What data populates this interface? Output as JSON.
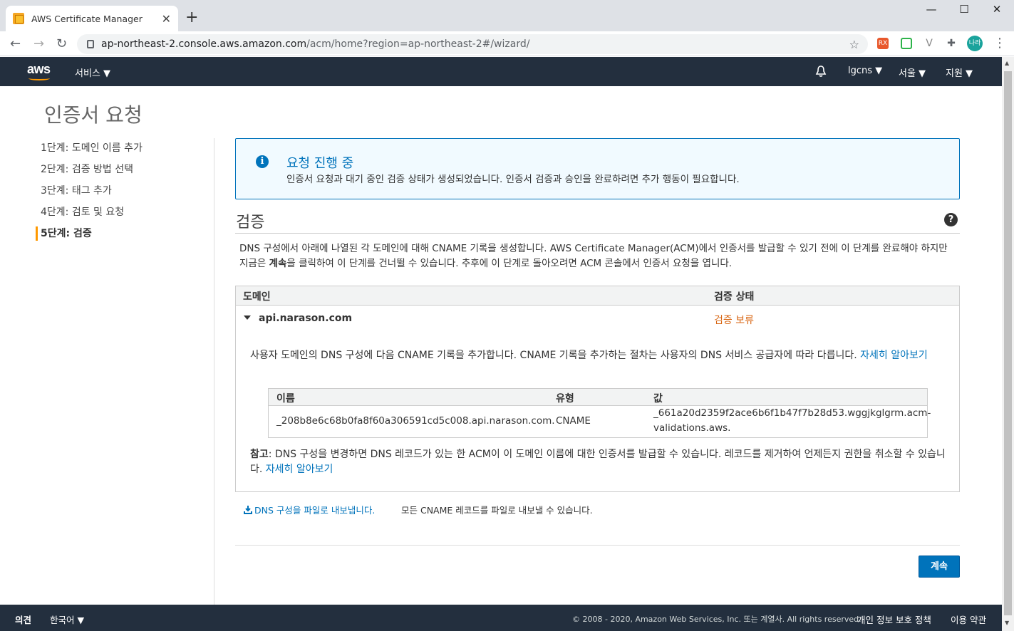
{
  "browser": {
    "tab_title": "AWS Certificate Manager",
    "url_host": "ap-northeast-2.console.aws.amazon.com",
    "url_path": "/acm/home?region=ap-northeast-2#/wizard/",
    "profile_label": "나라",
    "ext_label": "RX"
  },
  "header": {
    "logo": "aws",
    "services": "서비스 ▼",
    "account": "lgcns ▼",
    "region": "서울 ▼",
    "support": "지원 ▼"
  },
  "page": {
    "title": "인증서 요청"
  },
  "steps": [
    {
      "label": "1단계: 도메인 이름 추가"
    },
    {
      "label": "2단계: 검증 방법 선택"
    },
    {
      "label": "3단계: 태그 추가"
    },
    {
      "label": "4단계: 검토 및 요청"
    },
    {
      "label": "5단계: 검증"
    }
  ],
  "alert": {
    "title": "요청 진행 중",
    "body": "인증서 요청과 대기 중인 검증 상태가 생성되었습니다. 인증서 검증과 승인을 완료하려면 추가 행동이 필요합니다."
  },
  "validation": {
    "heading": "검증",
    "desc_1": "DNS 구성에서 아래에 나열된 각 도메인에 대해 CNAME 기록을 생성합니다. AWS Certificate Manager(ACM)에서 인증서를 발급할 수 있기 전에 이 단계를 완료해야 하지만 지금은 ",
    "desc_bold": "계속",
    "desc_2": "을 클릭하여 이 단계를 건너뛸 수 있습니다. 추후에 이 단계로 돌아오려면 ACM 콘솔에서 인증서 요청을 엽니다.",
    "col_domain": "도메인",
    "col_status": "검증 상태",
    "domain": "api.narason.com",
    "status": "검증 보류",
    "inner_desc": "사용자 도메인의 DNS 구성에 다음 CNAME 기록을 추가합니다. CNAME 기록을 추가하는 절차는 사용자의 DNS 서비스 공급자에 따라 다릅니다. ",
    "inner_link": "자세히 알아보기",
    "cname_cols": {
      "name": "이름",
      "type": "유형",
      "value": "값"
    },
    "cname_row": {
      "name": "_208b8e6c68b0fa8f60a306591cd5c008.api.narason.com.",
      "type": "CNAME",
      "value_1": "_661a20d2359f2ace6b6f1b47f7b28d53.wggjkglgrm.acm-",
      "value_2": "validations.aws."
    },
    "note_bold": "참고",
    "note_text": ": DNS 구성을 변경하면 DNS 레코드가 있는 한 ACM이 이 도메인 이름에 대한 인증서를 발급할 수 있습니다. 레코드를 제거하여 언제든지 권한을 취소할 수 있습니다. ",
    "note_link": "자세히 알아보기"
  },
  "export": {
    "link": "DNS 구성을 파일로 내보냅니다.",
    "desc": "모든 CNAME 레코드를 파일로 내보낼 수 있습니다."
  },
  "buttons": {
    "continue": "계속"
  },
  "footer": {
    "feedback": "의견",
    "language": "한국어 ▼",
    "copyright": "© 2008 - 2020, Amazon Web Services, Inc. 또는 계열사. All rights reserved.",
    "privacy": "개인 정보 보호 정책",
    "terms": "이용 약관"
  }
}
